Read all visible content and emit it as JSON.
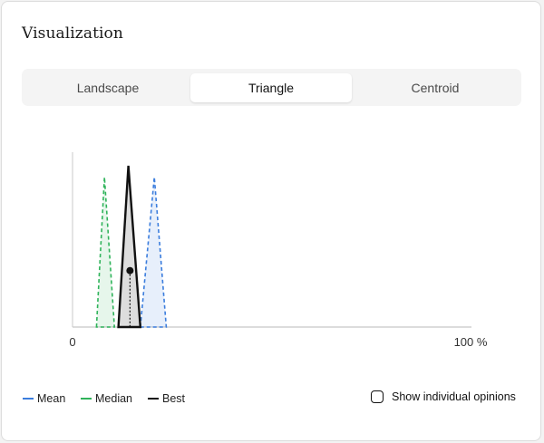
{
  "panel": {
    "title": "Visualization"
  },
  "tabs": [
    {
      "label": "Landscape",
      "active": false
    },
    {
      "label": "Triangle",
      "active": true
    },
    {
      "label": "Centroid",
      "active": false
    }
  ],
  "chart_data": {
    "type": "area",
    "x_axis": {
      "min_label": "0",
      "max_label": "100 %",
      "range": [
        0,
        100
      ]
    },
    "series": [
      {
        "name": "Mean",
        "color": "#3b7ddd",
        "style": "dashed",
        "low": 17,
        "peak": 20.5,
        "high": 23.5,
        "peak_height": 0.93
      },
      {
        "name": "Median",
        "color": "#2fb35a",
        "style": "dashed",
        "low": 6,
        "peak": 8,
        "high": 10.5,
        "peak_height": 0.93
      },
      {
        "name": "Best",
        "color": "#111111",
        "style": "solid",
        "low": 11.5,
        "peak": 14,
        "high": 17,
        "peak_height": 1.0,
        "marker": 14.4,
        "marker_height": 0.35
      }
    ]
  },
  "legend": [
    {
      "label": "Mean",
      "color": "#3b7ddd"
    },
    {
      "label": "Median",
      "color": "#2fb35a"
    },
    {
      "label": "Best",
      "color": "#111111"
    }
  ],
  "options": {
    "show_individual_label": "Show individual opinions",
    "show_individual_checked": false
  }
}
